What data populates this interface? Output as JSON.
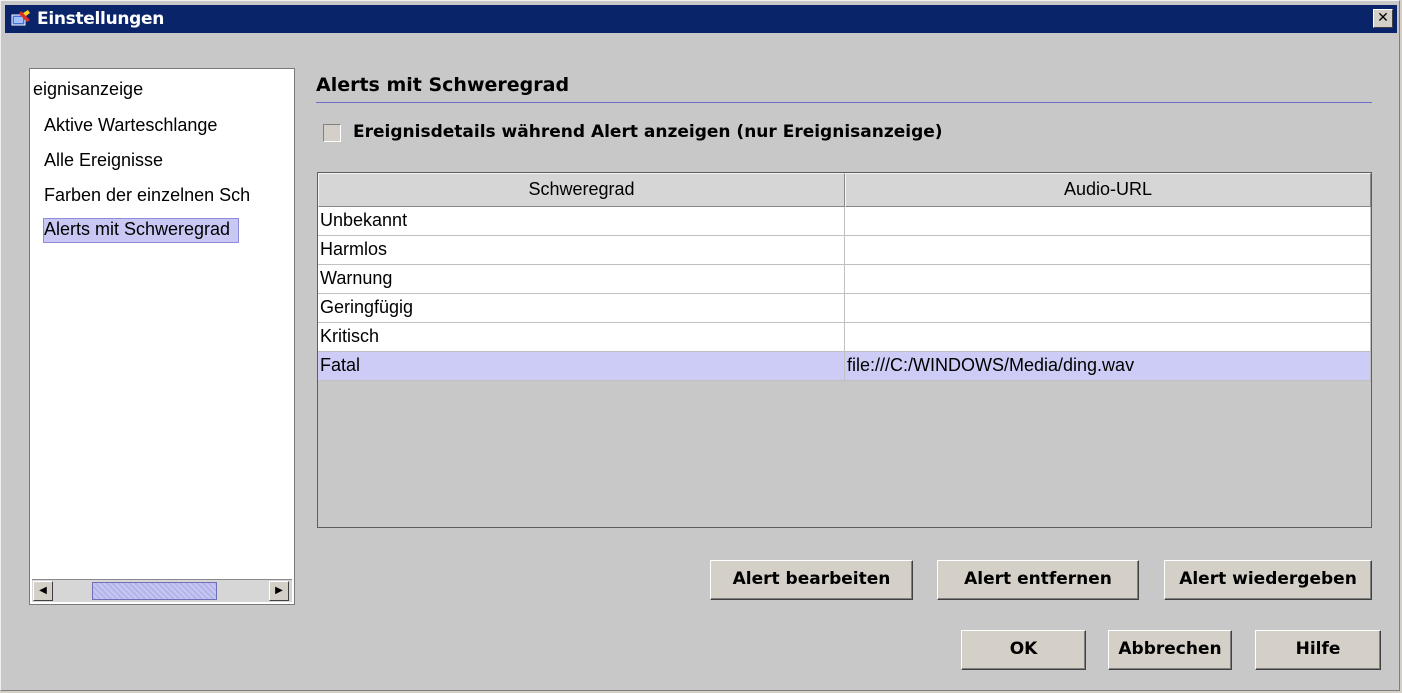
{
  "window": {
    "title": "Einstellungen",
    "close_label": "✕"
  },
  "nav": {
    "root_label": "eignisanzeige",
    "items": [
      {
        "label": "Aktive Warteschlange",
        "selected": false
      },
      {
        "label": "Alle Ereignisse",
        "selected": false
      },
      {
        "label": "Farben der einzelnen Sch",
        "selected": false
      },
      {
        "label": "Alerts mit Schweregrad",
        "selected": true
      }
    ],
    "scroll_left": "◀",
    "scroll_right": "▶"
  },
  "panel": {
    "title": "Alerts mit Schweregrad",
    "checkbox_label": "Ereignisdetails während Alert anzeigen (nur Ereignisanzeige)",
    "checkbox_checked": false
  },
  "table": {
    "columns": [
      "Schweregrad",
      "Audio-URL"
    ],
    "rows": [
      {
        "severity": "Unbekannt",
        "url": ""
      },
      {
        "severity": "Harmlos",
        "url": ""
      },
      {
        "severity": "Warnung",
        "url": ""
      },
      {
        "severity": "Geringfügig",
        "url": ""
      },
      {
        "severity": "Kritisch",
        "url": ""
      },
      {
        "severity": "Fatal",
        "url": "file:///C:/WINDOWS/Media/ding.wav",
        "selected": true
      }
    ]
  },
  "actions": {
    "edit": "Alert bearbeiten",
    "remove": "Alert entfernen",
    "play": "Alert wiedergeben"
  },
  "footer": {
    "ok": "OK",
    "cancel": "Abbrechen",
    "help": "Hilfe"
  },
  "colors": {
    "titlebar": "#0a246a",
    "selection": "#ccccf6",
    "dialog_bg": "#c8c8c8"
  }
}
